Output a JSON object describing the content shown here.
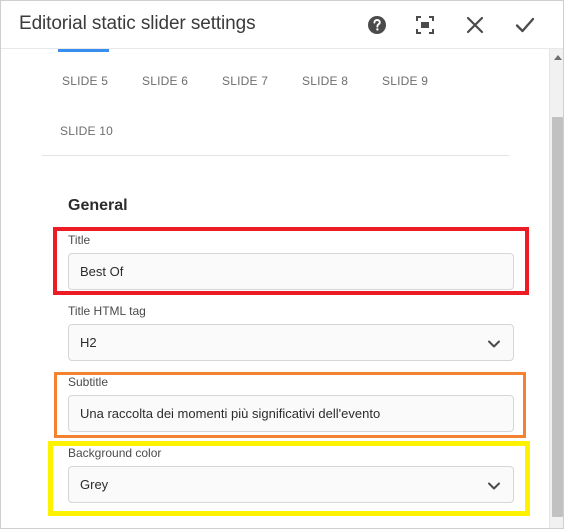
{
  "dialog": {
    "title": "Editorial static slider settings",
    "header_icons": [
      "help-icon",
      "fullscreen-icon",
      "close-icon",
      "check-icon"
    ]
  },
  "tabs": [
    "SLIDE 5",
    "SLIDE 6",
    "SLIDE 7",
    "SLIDE 8",
    "SLIDE 9",
    "SLIDE 10"
  ],
  "section": {
    "heading": "General"
  },
  "fields": {
    "title": {
      "label": "Title",
      "value": "Best Of"
    },
    "title_tag": {
      "label": "Title HTML tag",
      "value": "H2"
    },
    "subtitle": {
      "label": "Subtitle",
      "value": "Una raccolta dei momenti più significativi dell'evento"
    },
    "background_color": {
      "label": "Background color",
      "value": "Grey"
    }
  },
  "colors": {
    "accent": "#378ef0",
    "highlight_red": "#ed1c24",
    "highlight_orange": "#f58230",
    "highlight_yellow": "#fff200"
  }
}
